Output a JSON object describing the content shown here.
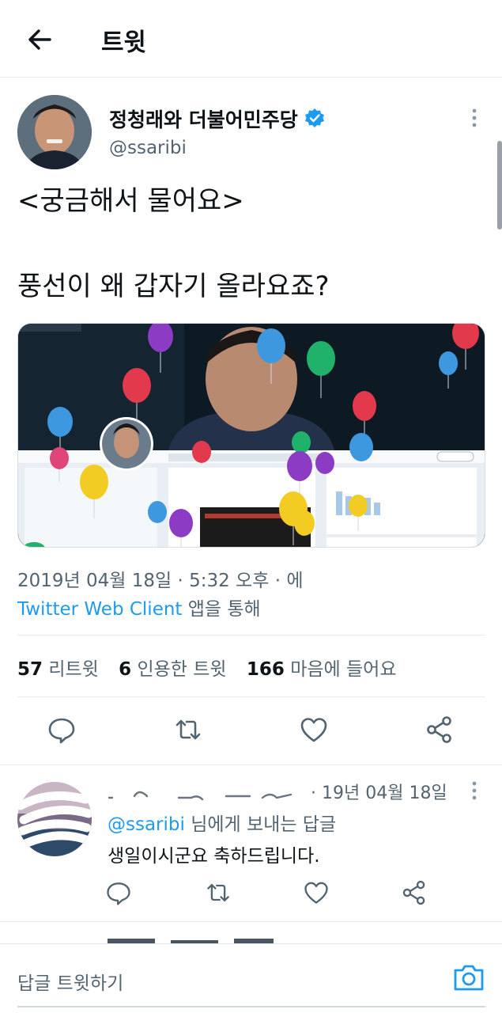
{
  "header": {
    "title": "트윗"
  },
  "tweet": {
    "author_name": "정청래와 더불어민주당",
    "author_handle": "@ssaribi",
    "text_line1": "<궁금해서 물어요>",
    "text_line2": "풍선이 왜 갑자기 올라요죠?",
    "timestamp": "2019년 04월 18일 · 5:32 오후 · 에",
    "client_name": "Twitter Web Client",
    "client_suffix": " 앱을 통해"
  },
  "stats": {
    "retweets_count": "57",
    "retweets_label": "리트윗",
    "quotes_count": "6",
    "quotes_label": "인용한 트윗",
    "likes_count": "166",
    "likes_label": "마음에 들어요"
  },
  "reply": {
    "date": "· 19년 04월 18일",
    "mention": "@ssaribi",
    "reply_to_suffix": " 님에게 보내는 답글",
    "text": "생일이시군요 축하드립니다."
  },
  "composer": {
    "placeholder": "답글 트윗하기"
  },
  "colors": {
    "accent": "#1d9bf0",
    "text": "#0f1419",
    "secondary": "#536471",
    "divider": "#e6ecf0"
  },
  "icons": [
    "back-arrow-icon",
    "verified-badge-icon",
    "more-options-icon",
    "reply-icon",
    "retweet-icon",
    "like-icon",
    "share-icon",
    "camera-icon"
  ]
}
